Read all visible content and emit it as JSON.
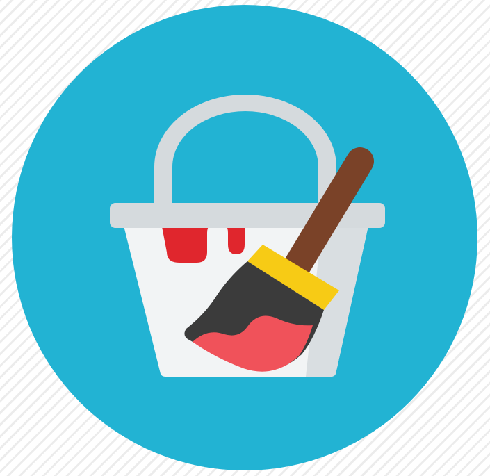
{
  "icon": {
    "name": "paint-bucket-with-brush",
    "colors": {
      "background_circle": "#22b3d3",
      "background_stripes": "#ececec",
      "bucket_body": "#f2f4f5",
      "bucket_shade": "#d9dee1",
      "bucket_rim": "#d5dadd",
      "bucket_handle": "#d5dadd",
      "paint_drip": "#e0262d",
      "brush_handle": "#7a4228",
      "brush_ferrule": "#f7cb15",
      "brush_bristles": "#3b3b3b",
      "brush_paint": "#f0525a"
    }
  }
}
